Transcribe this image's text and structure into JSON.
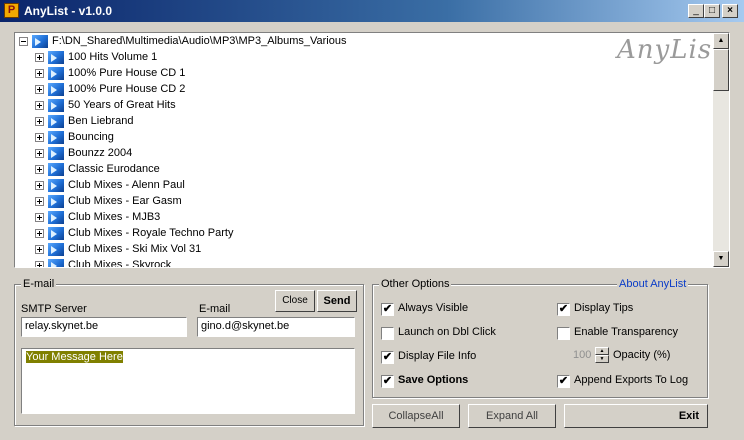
{
  "window": {
    "title": "AnyList - v1.0.0",
    "minimize": "_",
    "maximize": "□",
    "close": "×"
  },
  "tree": {
    "root": "F:\\DN_Shared\\Multimedia\\Audio\\MP3\\MP3_Albums_Various",
    "items": [
      "100 Hits Volume 1",
      "100% Pure House CD 1",
      "100% Pure House CD 2",
      "50 Years of Great Hits",
      "Ben Liebrand",
      "Bouncing",
      "Bounzz 2004",
      "Classic Eurodance",
      "Club Mixes - Alenn Paul",
      "Club Mixes - Ear Gasm",
      "Club Mixes - MJB3",
      "Club Mixes - Royale Techno Party",
      "Club Mixes - Ski Mix Vol 31",
      "Club Mixes - Skyrock"
    ],
    "logo": "AnyList",
    "scroll_up": "▲",
    "scroll_down": "▼"
  },
  "email": {
    "group_title": "E-mail",
    "smtp_label": "SMTP Server",
    "smtp_value": "relay.skynet.be",
    "email_label": "E-mail",
    "email_value": "gino.d@skynet.be",
    "close_label": "Close",
    "send_label": "Send",
    "message": "Your Message Here"
  },
  "options": {
    "group_title": "Other Options",
    "about_link": "About AnyList",
    "always_visible": {
      "label": "Always Visible",
      "checked": true
    },
    "launch_dbl_click": {
      "label": "Launch on Dbl Click",
      "checked": false
    },
    "display_file_info": {
      "label": "Display File Info",
      "checked": true
    },
    "save_options": {
      "label": "Save Options",
      "checked": true
    },
    "display_tips": {
      "label": "Display Tips",
      "checked": true
    },
    "enable_transparency": {
      "label": "Enable Transparency",
      "checked": false
    },
    "opacity_value": "100",
    "opacity_label": "Opacity (%)",
    "append_exports": {
      "label": "Append Exports To Log",
      "checked": true
    }
  },
  "buttons": {
    "collapse_all": "CollapseAll",
    "expand_all": "Expand All",
    "exit": "Exit"
  },
  "colors": {
    "titlebar_start": "#0a246a",
    "titlebar_end": "#a6caf0",
    "link": "#0a3cc8",
    "message_highlight": "#808000"
  }
}
